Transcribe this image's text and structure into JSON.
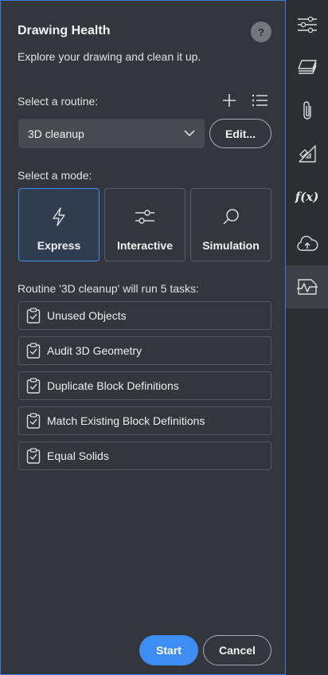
{
  "header": {
    "title": "Drawing Health",
    "help_label": "?",
    "subtitle": "Explore your drawing and clean it up."
  },
  "routine": {
    "label": "Select a routine:",
    "add_icon": "plus-icon",
    "list_icon": "list-icon",
    "selected": "3D cleanup",
    "edit_label": "Edit..."
  },
  "mode": {
    "label": "Select a mode:",
    "options": [
      {
        "label": "Express",
        "icon": "lightning-icon",
        "selected": true
      },
      {
        "label": "Interactive",
        "icon": "sliders-icon",
        "selected": false
      },
      {
        "label": "Simulation",
        "icon": "magnifier-icon",
        "selected": false
      }
    ]
  },
  "tasks": {
    "heading": "Routine '3D cleanup' will run 5 tasks:",
    "items": [
      {
        "label": "Unused Objects"
      },
      {
        "label": "Audit 3D Geometry"
      },
      {
        "label": "Duplicate Block Definitions"
      },
      {
        "label": "Match Existing Block Definitions"
      },
      {
        "label": "Equal Solids"
      }
    ]
  },
  "footer": {
    "start_label": "Start",
    "cancel_label": "Cancel"
  },
  "sidebar": {
    "items": [
      {
        "icon": "properties-sliders-icon"
      },
      {
        "icon": "layers-icon"
      },
      {
        "icon": "attachments-icon"
      },
      {
        "icon": "drawing-tools-icon"
      },
      {
        "icon": "function-icon",
        "label": "f(x)"
      },
      {
        "icon": "cloud-upload-icon"
      },
      {
        "icon": "drawing-health-icon",
        "active": true
      }
    ]
  },
  "colors": {
    "accent": "#3d8df5",
    "panel_bg": "#33363c",
    "sidebar_bg": "#2b2e33"
  }
}
